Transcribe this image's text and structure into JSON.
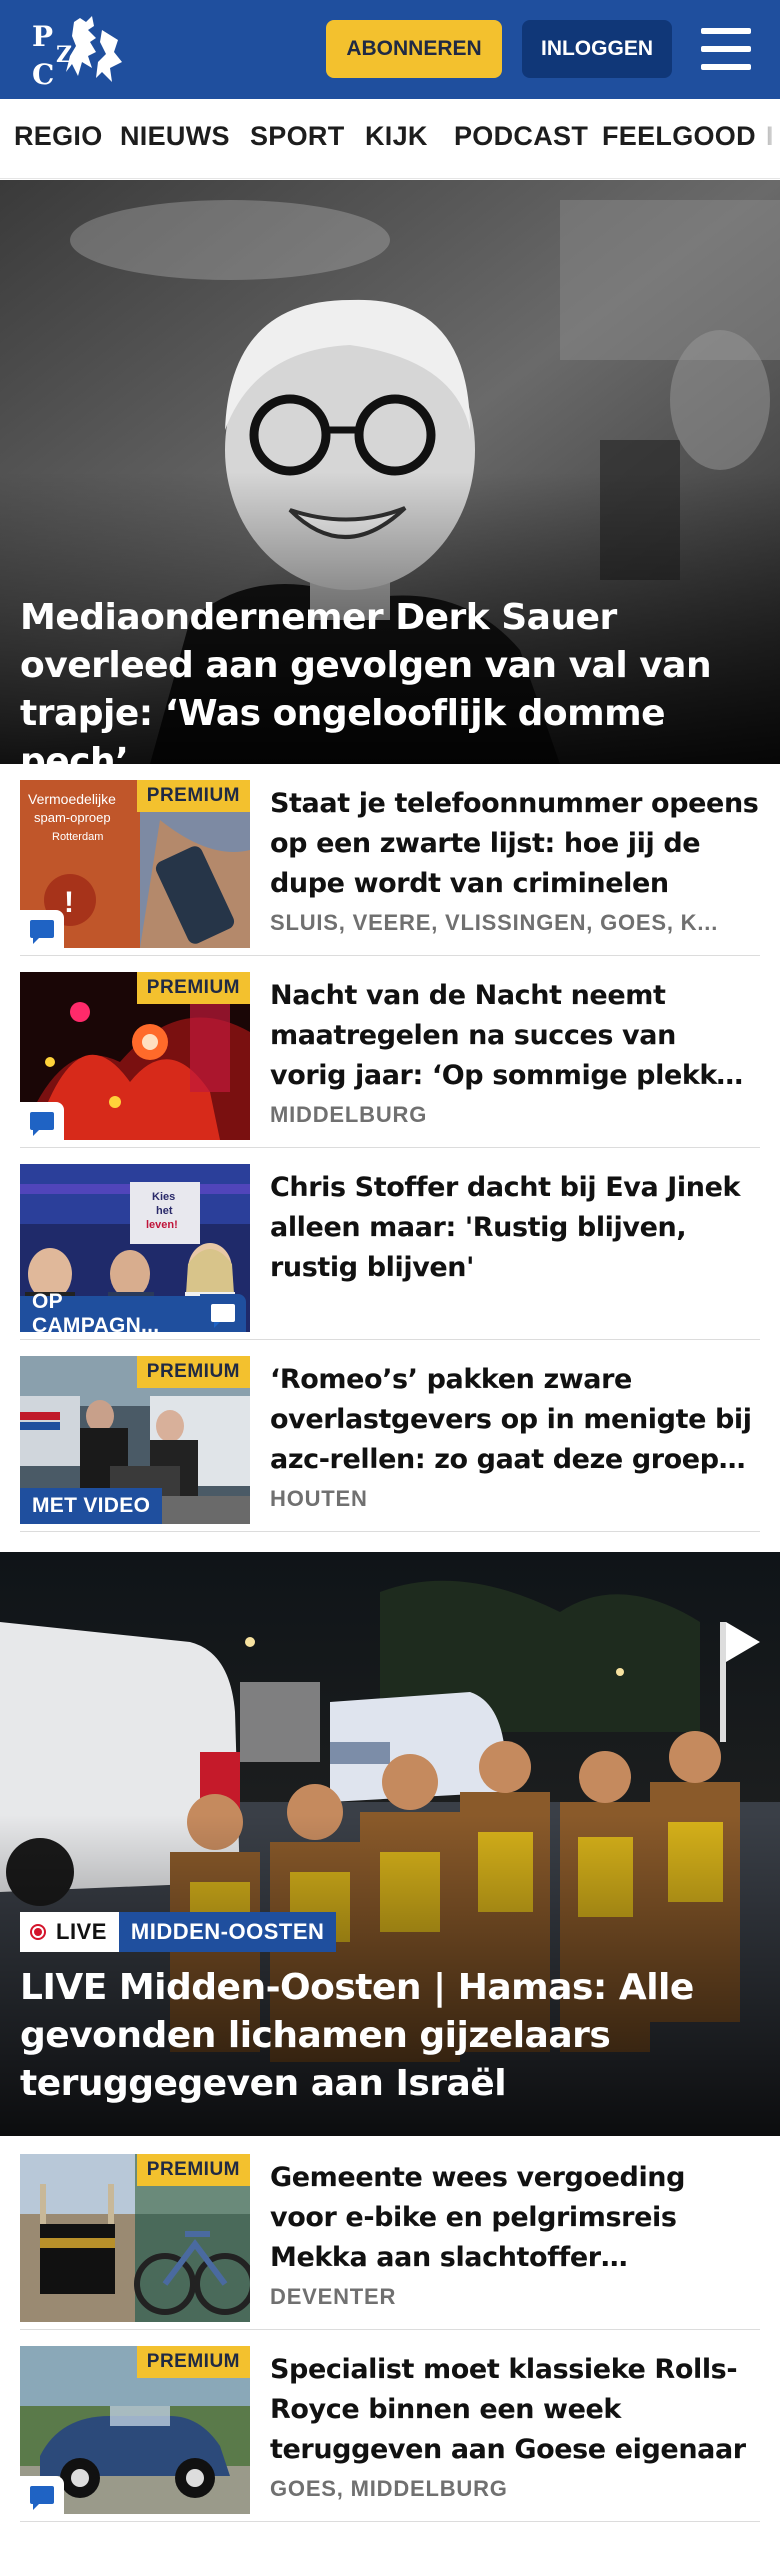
{
  "header": {
    "logo_text": "PZC",
    "subscribe_label": "ABONNEREN",
    "login_label": "INLOGGEN"
  },
  "nav": {
    "items": [
      "REGIO",
      "NIEUWS",
      "SPORT",
      "KIJK",
      "PODCAST",
      "FEELGOOD",
      "I"
    ]
  },
  "hero": {
    "title": "Mediaondernemer Derk Sauer overleed aan gevolgen van val van trapje: ‘Was ongelooflijk domme pech’"
  },
  "articles": [
    {
      "title": "Staat je telefoonnummer opeens op een zwarte lijst: hoe jij de dupe wordt van criminelen",
      "meta": "SLUIS, VEERE, VLISSINGEN, GOES, K...",
      "premium": "PREMIUM",
      "thumb_text": [
        "Vermoedelijke",
        "spam-oproep",
        "Rotterdam"
      ]
    },
    {
      "title": "Nacht van de Nacht neemt maatregelen na succes van vorig jaar: ‘Op sommige plekken was…",
      "meta": "MIDDELBURG",
      "premium": "PREMIUM"
    },
    {
      "title": "Chris Stoffer dacht bij Eva Jinek alleen maar: 'Rustig blijven, rustig blijven'",
      "tag": "OP CAMPAGN...",
      "thumb_text": [
        "Kies",
        "het",
        "leven!"
      ]
    },
    {
      "title": "‘Romeo’s’ pakken zware overlastgevers op in menigte bij azc-rellen: zo gaat deze groep t…",
      "meta": "HOUTEN",
      "premium": "PREMIUM",
      "tag": "MET VIDEO"
    }
  ],
  "live": {
    "live_label": "LIVE",
    "section_label": "MIDDEN-OOSTEN",
    "title": "LIVE Midden-Oosten | Hamas: Alle gevonden lichamen gijzelaars teruggegeven aan Israël"
  },
  "articles2": [
    {
      "title": "Gemeente wees vergoeding voor e-bike en pelgrimsreis Mekka aan slachtoffer toeslagenaffaire…",
      "meta": "DEVENTER",
      "premium": "PREMIUM"
    },
    {
      "title": "Specialist moet klassieke Rolls-Royce binnen een week teruggeven aan Goese eigenaar",
      "meta": "GOES, MIDDELBURG",
      "premium": "PREMIUM"
    }
  ]
}
